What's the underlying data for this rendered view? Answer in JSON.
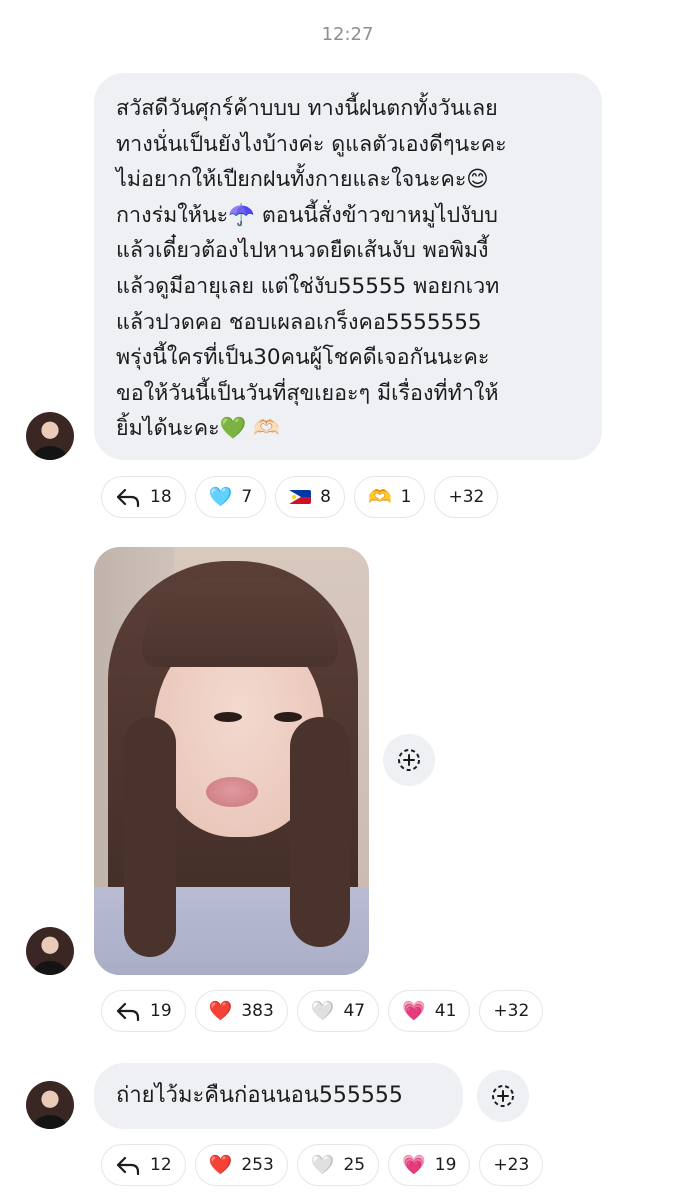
{
  "header": {
    "time": "12:27"
  },
  "messages": [
    {
      "type": "text",
      "lines": [
        "สวัสดีวันศุกร์ค้าบบบ ทางนี้ฝนตกทั้งวันเลย",
        "ทางนั่นเป็นยังไงบ้างค่ะ ดูแลตัวเองดีๆนะคะ",
        "ไม่อยากให้เปียกฝนทั้งกายและใจนะคะ😊",
        "กางร่มให้นะ☂️ ตอนนี้สั่งข้าวขาหมูไปงับบ",
        "แล้วเดี๋ยวต้องไปหานวดยืดเส้นงับ พอพิมงี้",
        "แล้วดูมีอายุเลย แต่ใช่งับ55555 พอยกเวท",
        "แล้วปวดคอ ชอบเผลอเกร็งคอ5555555",
        "พรุ่งนี้ใครที่เป็น30คนผู้โชคดีเจอกันนะคะ",
        "ขอให้วันนี้เป็นวันที่สุขเยอะๆ มีเรื่องที่ทำให้",
        "ยิ้มได้นะคะ💚 🫶🏻"
      ],
      "reactions": [
        {
          "icon": "reply-arrow",
          "emoji": "",
          "count": "18"
        },
        {
          "icon": "light-blue-heart",
          "emoji": "🩵",
          "count": "7"
        },
        {
          "icon": "philippines-flag",
          "emoji": "",
          "count": "8"
        },
        {
          "icon": "heart-hands",
          "emoji": "🫶",
          "count": "1"
        },
        {
          "icon": "more",
          "emoji": "",
          "count": "+32"
        }
      ]
    },
    {
      "type": "photo",
      "reactions": [
        {
          "icon": "reply-arrow",
          "emoji": "",
          "count": "19"
        },
        {
          "icon": "red-heart",
          "emoji": "❤️",
          "count": "383"
        },
        {
          "icon": "white-heart",
          "emoji": "🤍",
          "count": "47"
        },
        {
          "icon": "sparkling-heart",
          "emoji": "💗",
          "count": "41"
        },
        {
          "icon": "more",
          "emoji": "",
          "count": "+32"
        }
      ]
    },
    {
      "type": "text",
      "text": "ถ่ายไว้มะคืนก่อนนอน555555",
      "reactions": [
        {
          "icon": "reply-arrow",
          "emoji": "",
          "count": "12"
        },
        {
          "icon": "red-heart",
          "emoji": "❤️",
          "count": "253"
        },
        {
          "icon": "white-heart",
          "emoji": "🤍",
          "count": "25"
        },
        {
          "icon": "sparkling-heart",
          "emoji": "💗",
          "count": "19"
        },
        {
          "icon": "more",
          "emoji": "",
          "count": "+23"
        }
      ]
    }
  ]
}
